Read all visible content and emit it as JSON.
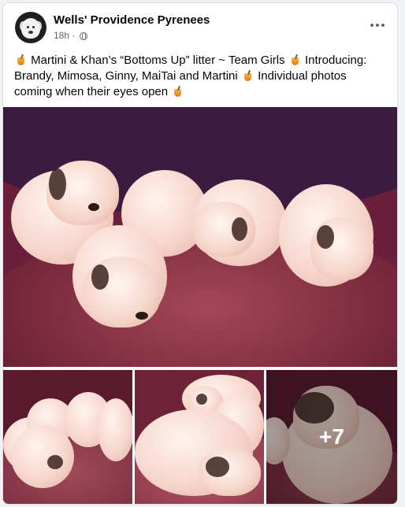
{
  "post": {
    "page_name": "Wells' Providence Pyrenees",
    "time": "18h",
    "separator": "·",
    "text_segments": [
      "Martini & Khan’s “Bottoms Up” litter ~ Team Girls",
      "Introducing: Brandy, Mimosa, Ginny, MaiTai and Martini",
      "Individual photos coming when their eyes open"
    ],
    "more_photos_label": "+7"
  },
  "icons": {
    "more": "more-options-icon",
    "audience": "globe-icon",
    "emoji": "cocktail-emoji-icon"
  },
  "colors": {
    "background": "#f0f2f5",
    "card": "#ffffff",
    "text_primary": "#050505",
    "text_secondary": "#65676b"
  }
}
